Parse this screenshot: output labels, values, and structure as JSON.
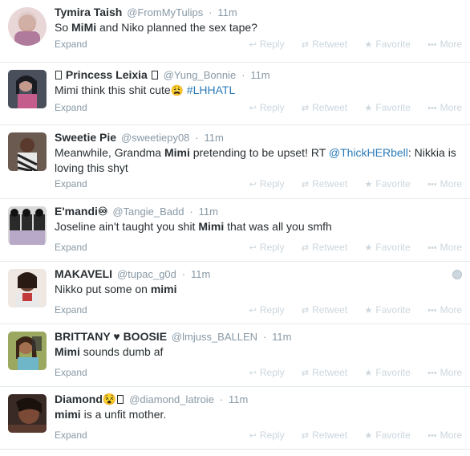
{
  "actions": {
    "expand": "Expand",
    "reply": "Reply",
    "retweet": "Retweet",
    "favorite": "Favorite",
    "more": "More"
  },
  "tweets": [
    {
      "fullname": "Tymira Taish",
      "username": "@FromMyTulips",
      "time": "11m",
      "text_parts": [
        "So ",
        "MiMi",
        " and Niko planned the sex tape?"
      ]
    },
    {
      "fullname": "Princess Leixia",
      "username": "@Yung_Bonnie",
      "time": "11m",
      "text_parts": [
        "Mimi think this shit cute",
        "😩",
        " ",
        "#LHHATL"
      ]
    },
    {
      "fullname": "Sweetie Pie",
      "username": "@sweetiepy08",
      "time": "11m",
      "text_parts": [
        "Meanwhile, Grandma ",
        "Mimi",
        " pretending to be upset! RT ",
        "@ThickHERbell",
        ": Nikkia is loving this shyt"
      ]
    },
    {
      "fullname": "E'mandi",
      "username": "@Tangie_Badd",
      "time": "11m",
      "text_parts": [
        "Joseline ain't taught you shit ",
        "Mimi",
        " that was all you smfh"
      ]
    },
    {
      "fullname": "MAKAVELI",
      "username": "@tupac_g0d",
      "time": "11m",
      "text_parts": [
        "Nikko put some on ",
        "mimi"
      ]
    },
    {
      "fullname": "BRITTANY ♥ BOOSIE",
      "username": "@lmjuss_BALLEN",
      "time": "11m",
      "text_parts": [
        "Mimi",
        " sounds dumb af"
      ]
    },
    {
      "fullname": "Diamond",
      "username": "@diamond_latroie",
      "time": "11m",
      "text_parts": [
        "mimi",
        " is a unfit mother."
      ]
    }
  ]
}
